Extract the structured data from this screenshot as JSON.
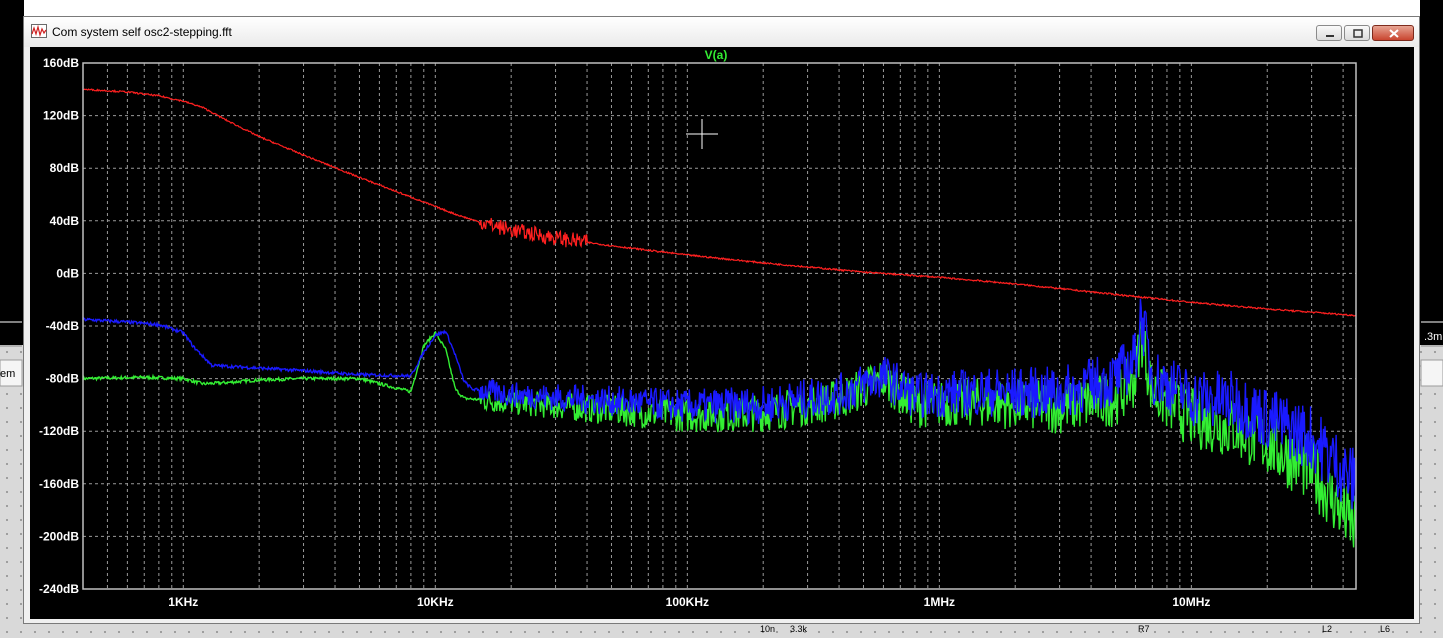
{
  "window": {
    "title": "Com system self osc2-stepping.fft",
    "icon": "waveform-icon"
  },
  "background": {
    "left_label": "em",
    "right_label": ".3m",
    "bottom_labels": [
      "R7",
      "10n",
      "3.3k",
      "L2",
      "L6"
    ]
  },
  "colors": {
    "plot_bg": "#000000",
    "grid": "#9a9a9a",
    "frame": "#c0c0c0",
    "trace_red": "#ff2020",
    "trace_blue": "#1a1aff",
    "trace_green": "#33ee33"
  },
  "chart_data": {
    "type": "line",
    "title": "V(a)",
    "xscale": "log",
    "xlim": [
      400,
      45000000
    ],
    "ylim": [
      -240,
      160
    ],
    "ylabel_unit": "dB",
    "yticks": [
      160,
      120,
      80,
      40,
      0,
      -40,
      -80,
      -120,
      -160,
      -200,
      -240
    ],
    "ytick_labels": [
      "160dB",
      "120dB",
      "80dB",
      "40dB",
      "0dB",
      "-40dB",
      "-80dB",
      "-120dB",
      "-160dB",
      "-200dB",
      "-240dB"
    ],
    "xticks": [
      1000,
      10000,
      100000,
      1000000,
      10000000
    ],
    "xtick_labels": [
      "1KHz",
      "10KHz",
      "100KHz",
      "1MHz",
      "10MHz"
    ],
    "grid": true,
    "series": [
      {
        "color": "red",
        "x": [
          400,
          600,
          800,
          1000,
          1200,
          1500,
          2000,
          3000,
          5000,
          8000,
          12000,
          15000,
          20000,
          30000,
          50000,
          100000,
          200000,
          500000,
          1000000,
          2000000,
          5000000,
          10000000,
          20000000,
          45000000
        ],
        "y": [
          140,
          138,
          135,
          131,
          126,
          116,
          104,
          90,
          73,
          58,
          45,
          39,
          33,
          27,
          21,
          14,
          8,
          1,
          -3,
          -8,
          -16,
          -22,
          -27,
          -32
        ]
      },
      {
        "color": "blue",
        "x": [
          400,
          600,
          800,
          1000,
          1100,
          1300,
          2000,
          3000,
          5000,
          8000,
          9000,
          10000,
          11000,
          12000,
          13000,
          14000,
          20000,
          50000,
          100000,
          200000,
          400000,
          600000,
          800000,
          1500000,
          3000000,
          5000000,
          6000000,
          6300000,
          7000000,
          10000000,
          15000000,
          20000000,
          30000000,
          45000000
        ],
        "y": [
          -35,
          -37,
          -39,
          -45,
          -56,
          -70,
          -72,
          -74,
          -77,
          -78,
          -60,
          -47,
          -44,
          -62,
          -82,
          -88,
          -92,
          -97,
          -101,
          -100,
          -92,
          -78,
          -93,
          -90,
          -91,
          -80,
          -65,
          -30,
          -78,
          -94,
          -98,
          -110,
          -125,
          -160
        ]
      },
      {
        "color": "green",
        "x": [
          400,
          700,
          1000,
          1200,
          1500,
          2000,
          3000,
          5000,
          8000,
          9000,
          10000,
          11000,
          12000,
          13000,
          20000,
          50000,
          100000,
          200000,
          400000,
          600000,
          800000,
          1500000,
          3000000,
          5000000,
          6000000,
          6300000,
          7000000,
          10000000,
          15000000,
          20000000,
          30000000,
          45000000
        ],
        "y": [
          -80,
          -79,
          -80,
          -84,
          -83,
          -81,
          -80,
          -80,
          -90,
          -55,
          -45,
          -58,
          -88,
          -95,
          -98,
          -104,
          -108,
          -106,
          -96,
          -80,
          -100,
          -98,
          -102,
          -95,
          -80,
          -45,
          -90,
          -110,
          -118,
          -130,
          -150,
          -195
        ]
      }
    ]
  }
}
